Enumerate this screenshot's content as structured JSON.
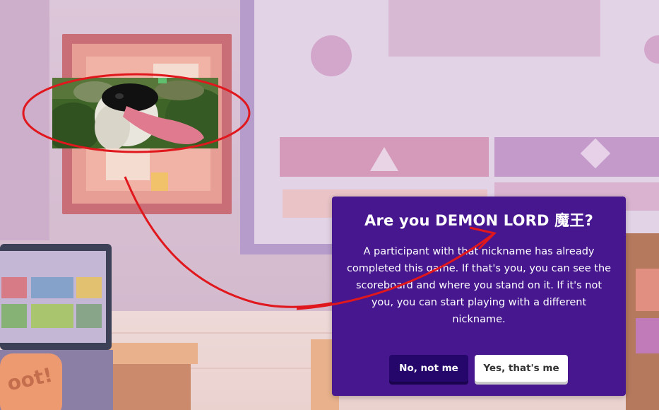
{
  "dialog": {
    "title": "Are you DEMON LORD 魔王?",
    "message": "A participant with that nickname has already completed this game. If that's you, you can see the scoreboard and where you stand on it. If it's not you, you can start playing with a different nickname.",
    "no_button": "No, not me",
    "yes_button": "Yes, that's me"
  },
  "background": {
    "chair_text": "oot!"
  },
  "colors": {
    "dialog_bg": "#46178f",
    "no_button_bg": "#25076b",
    "yes_button_bg": "#ffffff",
    "annotation": "#e0171c"
  }
}
